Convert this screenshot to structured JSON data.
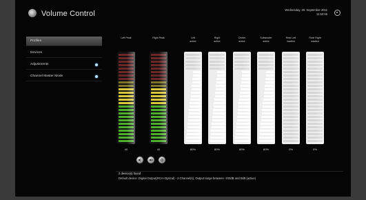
{
  "app": {
    "title": "Volume Control",
    "date_line1": "Wednesday, 28. September 2011",
    "date_line2": "11:50:55"
  },
  "sidebar": {
    "items": [
      {
        "label": "Profiles",
        "selected": true,
        "has_indicator": false
      },
      {
        "label": "Devices",
        "selected": false,
        "has_indicator": false
      },
      {
        "label": "Adjustments",
        "selected": false,
        "has_indicator": true
      },
      {
        "label": "Channel Master Mode",
        "selected": false,
        "has_indicator": true
      }
    ]
  },
  "meters": [
    {
      "label1": "Left Peak",
      "label2": "",
      "value": "40",
      "style": "color",
      "level": 0.4
    },
    {
      "label1": "Right Peak",
      "label2": "",
      "value": "40",
      "style": "color",
      "level": 0.4
    },
    {
      "label1": "Left",
      "label2": "active",
      "value": "80%",
      "style": "white",
      "level": 0.8
    },
    {
      "label1": "Right",
      "label2": "active",
      "value": "80%",
      "style": "white",
      "level": 0.8
    },
    {
      "label1": "Center",
      "label2": "active",
      "value": "80%",
      "style": "white",
      "level": 0.8
    },
    {
      "label1": "Subwoofer",
      "label2": "active",
      "value": "80%",
      "style": "white",
      "level": 0.8
    },
    {
      "label1": "Rear Left",
      "label2": "inactive",
      "value": "0%",
      "style": "white",
      "level": 0
    },
    {
      "label1": "Rear Right",
      "label2": "inactive",
      "value": "0%",
      "style": "white",
      "level": 0
    }
  ],
  "controls": [
    {
      "name": "speaker-settings-icon"
    },
    {
      "name": "mute-speaker-icon"
    },
    {
      "name": "settings-gear-icon"
    }
  ],
  "footer": {
    "line1": "2 device(s) found",
    "line2": "Default device: Digital Output(RCA+Optical) - 2 Channel(s), Output range between -103dB and 0dB (active)"
  },
  "colors": {
    "peak_green": "#4caf2a",
    "peak_yellow": "#d7c837",
    "peak_red": "#b8393c",
    "meter_white_bg": "#ededed",
    "indicator": "#bfe3ff"
  }
}
